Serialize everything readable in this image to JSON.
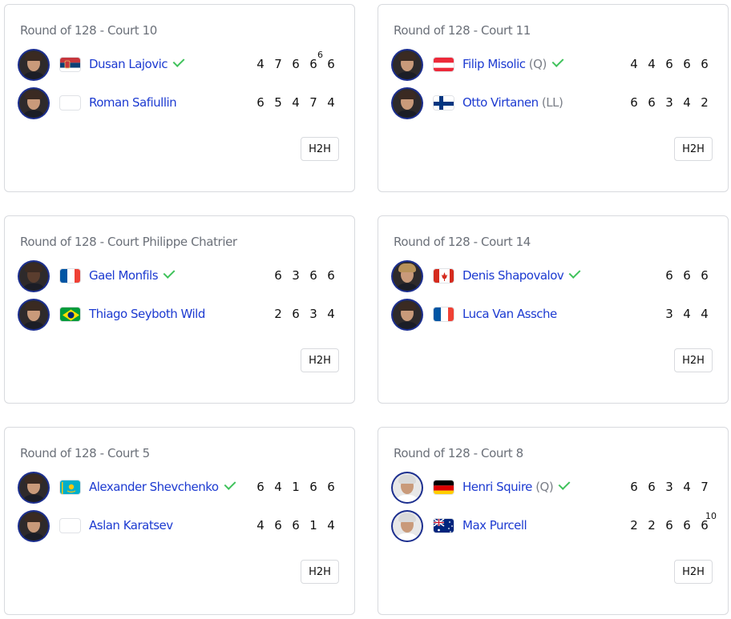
{
  "matches": [
    {
      "title": "Round of 128 - Court 10",
      "h2h_label": "H2H",
      "players": [
        {
          "name": "Dusan Lajovic",
          "tag": "",
          "flag": "serbia",
          "winner": true,
          "scores": [
            "4",
            "7",
            "6",
            "6",
            "6"
          ],
          "tiebreaks": [
            "",
            "",
            "",
            "6",
            ""
          ]
        },
        {
          "name": "Roman Safiullin",
          "tag": "",
          "flag": "blank",
          "winner": false,
          "scores": [
            "6",
            "5",
            "4",
            "7",
            "4"
          ],
          "tiebreaks": [
            "",
            "",
            "",
            "",
            ""
          ]
        }
      ]
    },
    {
      "title": "Round of 128 - Court 11",
      "h2h_label": "H2H",
      "players": [
        {
          "name": "Filip Misolic",
          "tag": "(Q)",
          "flag": "austria",
          "winner": true,
          "scores": [
            "4",
            "4",
            "6",
            "6",
            "6"
          ],
          "tiebreaks": [
            "",
            "",
            "",
            "",
            ""
          ]
        },
        {
          "name": "Otto Virtanen",
          "tag": "(LL)",
          "flag": "finland",
          "winner": false,
          "scores": [
            "6",
            "6",
            "3",
            "4",
            "2"
          ],
          "tiebreaks": [
            "",
            "",
            "",
            "",
            ""
          ]
        }
      ]
    },
    {
      "title": "Round of 128 - Court Philippe Chatrier",
      "h2h_label": "H2H",
      "players": [
        {
          "name": "Gael Monfils",
          "tag": "",
          "flag": "france",
          "winner": true,
          "scores": [
            "6",
            "3",
            "6",
            "6"
          ],
          "tiebreaks": [
            "",
            "",
            "",
            ""
          ]
        },
        {
          "name": "Thiago Seyboth Wild",
          "tag": "",
          "flag": "brazil",
          "winner": false,
          "scores": [
            "2",
            "6",
            "3",
            "4"
          ],
          "tiebreaks": [
            "",
            "",
            "",
            ""
          ]
        }
      ]
    },
    {
      "title": "Round of 128 - Court 14",
      "h2h_label": "H2H",
      "players": [
        {
          "name": "Denis Shapovalov",
          "tag": "",
          "flag": "canada",
          "winner": true,
          "scores": [
            "6",
            "6",
            "6"
          ],
          "tiebreaks": [
            "",
            "",
            ""
          ]
        },
        {
          "name": "Luca Van Assche",
          "tag": "",
          "flag": "france",
          "winner": false,
          "scores": [
            "3",
            "4",
            "4"
          ],
          "tiebreaks": [
            "",
            "",
            ""
          ]
        }
      ]
    },
    {
      "title": "Round of 128 - Court 5",
      "h2h_label": "H2H",
      "players": [
        {
          "name": "Alexander Shevchenko",
          "tag": "",
          "flag": "kazakhstan",
          "winner": true,
          "scores": [
            "6",
            "4",
            "1",
            "6",
            "6"
          ],
          "tiebreaks": [
            "",
            "",
            "",
            "",
            ""
          ]
        },
        {
          "name": "Aslan Karatsev",
          "tag": "",
          "flag": "blank",
          "winner": false,
          "scores": [
            "4",
            "6",
            "6",
            "1",
            "4"
          ],
          "tiebreaks": [
            "",
            "",
            "",
            "",
            ""
          ]
        }
      ]
    },
    {
      "title": "Round of 128 - Court 8",
      "h2h_label": "H2H",
      "players": [
        {
          "name": "Henri Squire",
          "tag": "(Q)",
          "flag": "germany",
          "winner": true,
          "scores": [
            "6",
            "6",
            "3",
            "4",
            "7"
          ],
          "tiebreaks": [
            "",
            "",
            "",
            "",
            ""
          ]
        },
        {
          "name": "Max Purcell",
          "tag": "",
          "flag": "australia",
          "winner": false,
          "scores": [
            "2",
            "2",
            "6",
            "6",
            "6"
          ],
          "tiebreaks": [
            "",
            "",
            "",
            "",
            "10"
          ]
        }
      ]
    }
  ],
  "colors": {
    "player_link": "#1d3bd1",
    "winner_check": "#3fc25b",
    "card_border": "#d8dade",
    "title_text": "#6b7079",
    "avatar_ring": "#1c2f8f"
  }
}
